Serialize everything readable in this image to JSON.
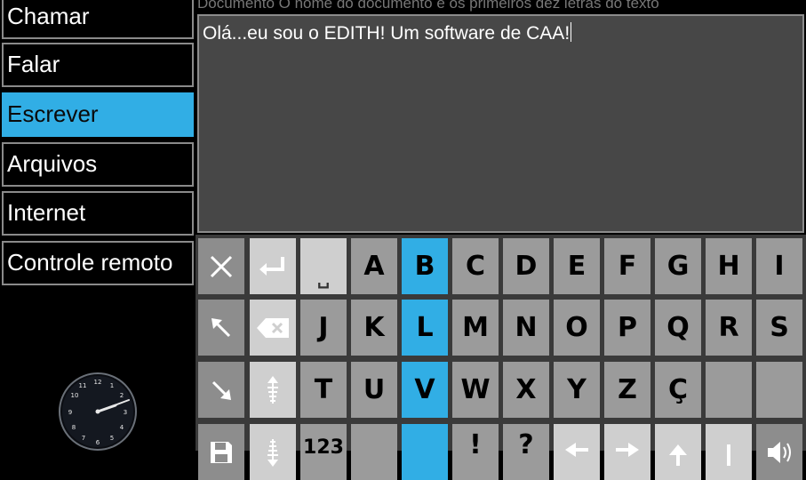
{
  "menu": {
    "items": [
      {
        "label": "Chamar"
      },
      {
        "label": "Falar"
      },
      {
        "label": "Escrever",
        "active": true
      },
      {
        "label": "Arquivos"
      },
      {
        "label": "Internet"
      },
      {
        "label": "Controle remoto"
      }
    ]
  },
  "document": {
    "header": "Documento O nome do documento e os primeiros dez letras do texto",
    "text": "Olá...eu sou o EDITH! Um software de CAA!"
  },
  "keyboard": {
    "row1": {
      "k3": "␣",
      "k4": "A",
      "k5": "B",
      "k6": "C",
      "k7": "D",
      "k8": "E",
      "k9": "F",
      "k10": "G",
      "k11": "H",
      "k12": "I"
    },
    "row2": {
      "k3": "J",
      "k4": "K",
      "k5": "L",
      "k6": "M",
      "k7": "N",
      "k8": "O",
      "k9": "P",
      "k10": "Q",
      "k11": "R",
      "k12": "S"
    },
    "row3": {
      "k3": "T",
      "k4": "U",
      "k5": "V",
      "k6": "W",
      "k7": "X",
      "k8": "Y",
      "k9": "Z",
      "k10": "Ç"
    },
    "row4": {
      "k3": "123",
      "k5": "!",
      "k6": "?"
    }
  },
  "colors": {
    "accent": "#31aee5",
    "background": "#000000",
    "document_bg": "#474747",
    "key_gray": "#9b9b9b",
    "key_light": "#cfcfcf"
  },
  "icons": [
    "close-icon",
    "enter-icon",
    "arrow-up-left-icon",
    "backspace-icon",
    "arrow-down-right-icon",
    "scroll-up-icon",
    "save-icon",
    "scroll-down-icon",
    "arrow-left-icon",
    "arrow-right-icon",
    "arrow-up-icon",
    "arrow-down-icon",
    "speaker-icon"
  ]
}
